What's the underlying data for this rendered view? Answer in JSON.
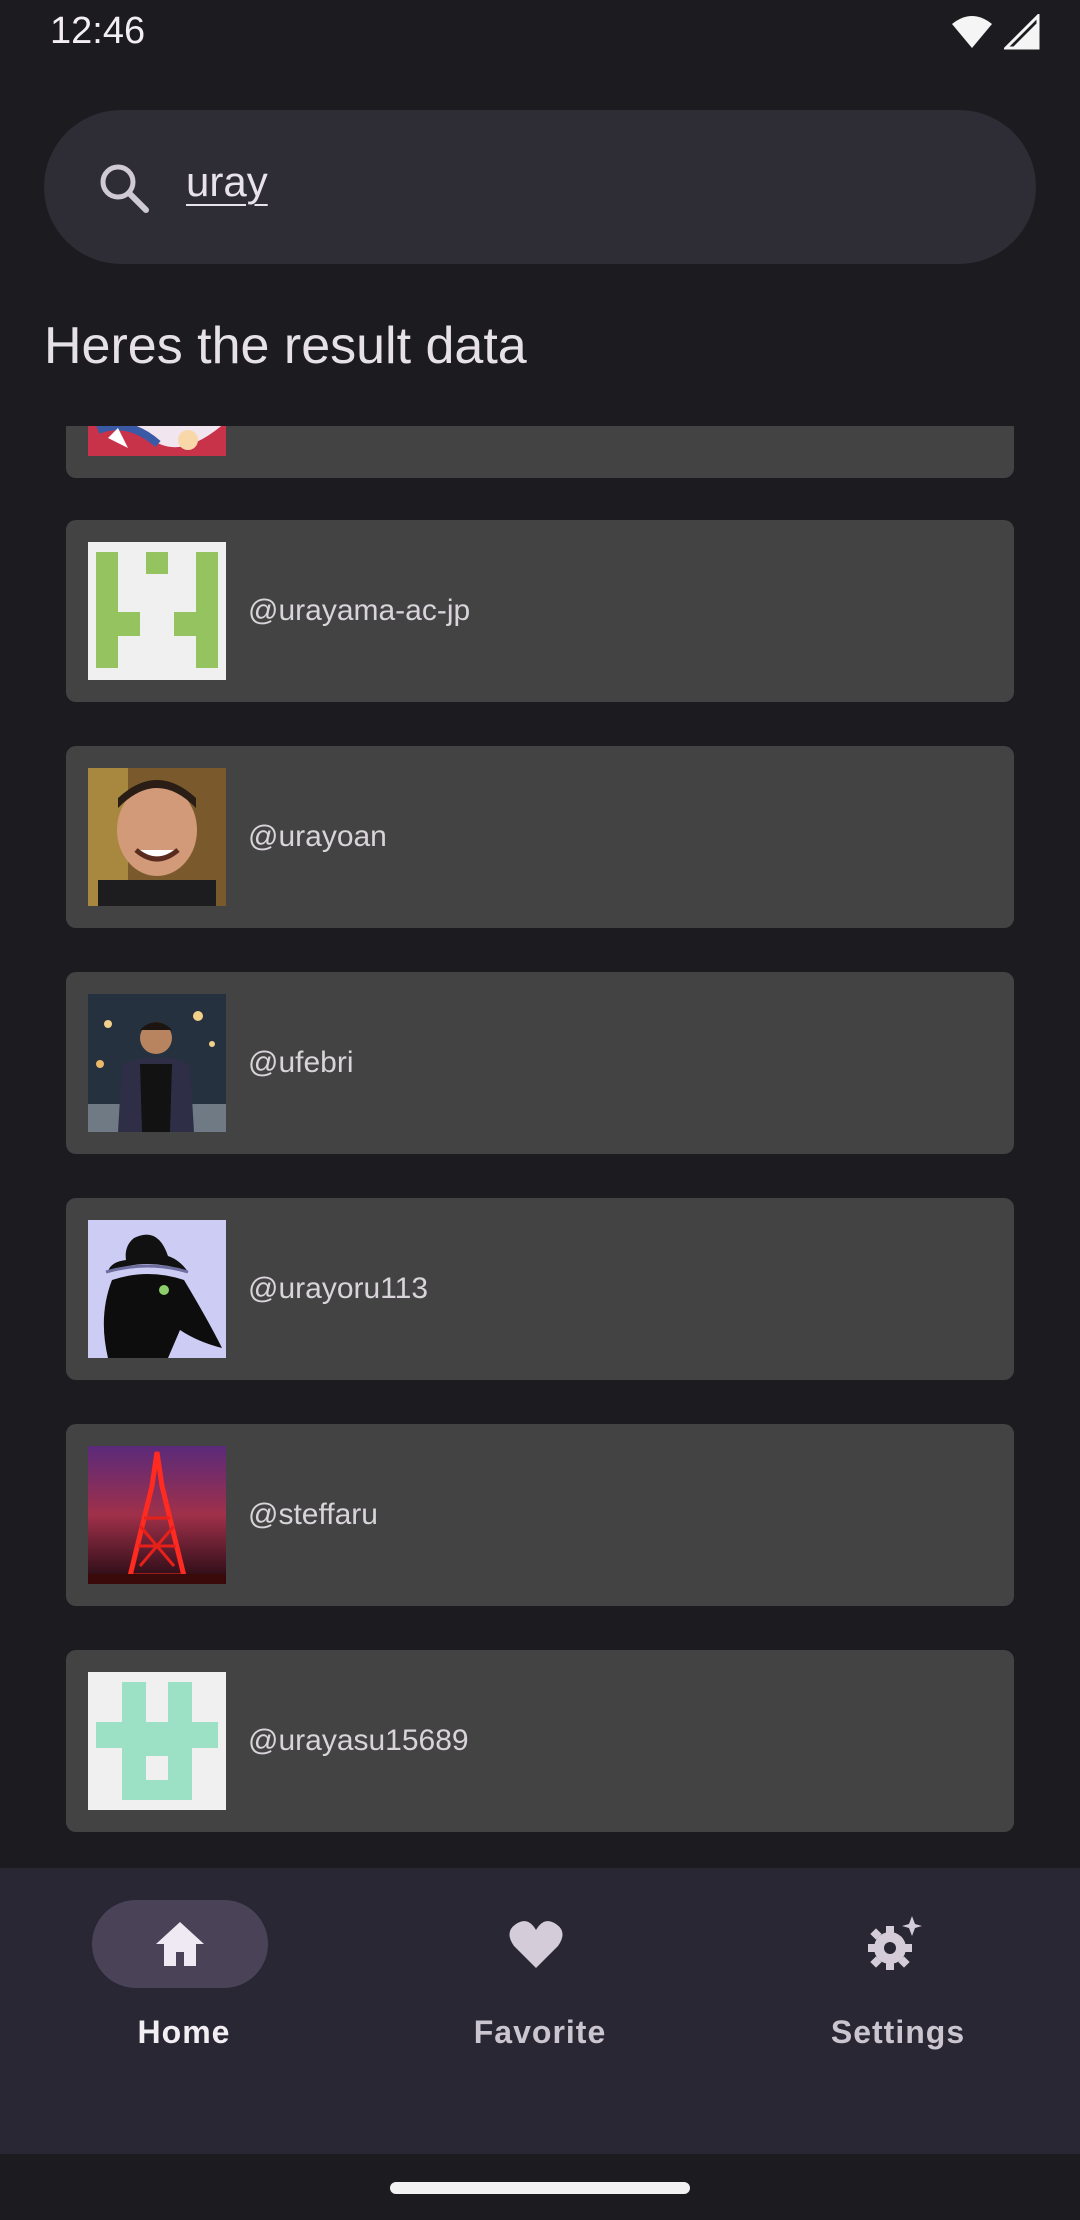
{
  "status_bar": {
    "time": "12:46",
    "icons": [
      "wifi-icon",
      "cellular-signal-icon"
    ]
  },
  "search": {
    "value": "uray",
    "icon": "search-icon"
  },
  "results": {
    "title": "Heres the result data",
    "items": [
      {
        "username": "",
        "avatar": "anime-art"
      },
      {
        "username": "@urayama-ac-jp",
        "avatar": "identicon-green"
      },
      {
        "username": "@urayoan",
        "avatar": "photo-man-smiling"
      },
      {
        "username": "@ufebri",
        "avatar": "photo-man-city-night"
      },
      {
        "username": "@urayoru113",
        "avatar": "drawing-bird-hat"
      },
      {
        "username": "@steffaru",
        "avatar": "photo-red-tower"
      },
      {
        "username": "@urayasu15689",
        "avatar": "identicon-mint"
      }
    ]
  },
  "bottom_nav": {
    "items": [
      {
        "label": "Home",
        "icon": "home-icon",
        "active": true
      },
      {
        "label": "Favorite",
        "icon": "heart-icon",
        "active": false
      },
      {
        "label": "Settings",
        "icon": "settings-sparkle-icon",
        "active": false
      }
    ]
  },
  "colors": {
    "background": "#1c1b20",
    "search_bar": "#2e2c35",
    "card": "#434343",
    "nav_bar": "#292733",
    "nav_active_pill": "#4a4358"
  }
}
